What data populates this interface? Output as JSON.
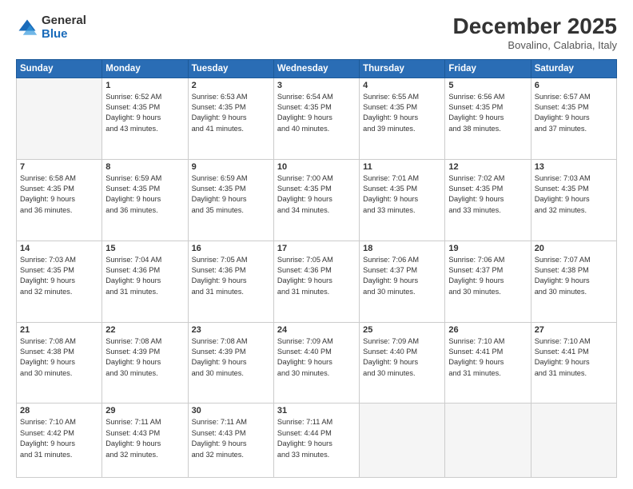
{
  "logo": {
    "general": "General",
    "blue": "Blue"
  },
  "header": {
    "month": "December 2025",
    "location": "Bovalino, Calabria, Italy"
  },
  "weekdays": [
    "Sunday",
    "Monday",
    "Tuesday",
    "Wednesday",
    "Thursday",
    "Friday",
    "Saturday"
  ],
  "weeks": [
    [
      {
        "day": "",
        "lines": []
      },
      {
        "day": "1",
        "lines": [
          "Sunrise: 6:52 AM",
          "Sunset: 4:35 PM",
          "Daylight: 9 hours",
          "and 43 minutes."
        ]
      },
      {
        "day": "2",
        "lines": [
          "Sunrise: 6:53 AM",
          "Sunset: 4:35 PM",
          "Daylight: 9 hours",
          "and 41 minutes."
        ]
      },
      {
        "day": "3",
        "lines": [
          "Sunrise: 6:54 AM",
          "Sunset: 4:35 PM",
          "Daylight: 9 hours",
          "and 40 minutes."
        ]
      },
      {
        "day": "4",
        "lines": [
          "Sunrise: 6:55 AM",
          "Sunset: 4:35 PM",
          "Daylight: 9 hours",
          "and 39 minutes."
        ]
      },
      {
        "day": "5",
        "lines": [
          "Sunrise: 6:56 AM",
          "Sunset: 4:35 PM",
          "Daylight: 9 hours",
          "and 38 minutes."
        ]
      },
      {
        "day": "6",
        "lines": [
          "Sunrise: 6:57 AM",
          "Sunset: 4:35 PM",
          "Daylight: 9 hours",
          "and 37 minutes."
        ]
      }
    ],
    [
      {
        "day": "7",
        "lines": [
          "Sunrise: 6:58 AM",
          "Sunset: 4:35 PM",
          "Daylight: 9 hours",
          "and 36 minutes."
        ]
      },
      {
        "day": "8",
        "lines": [
          "Sunrise: 6:59 AM",
          "Sunset: 4:35 PM",
          "Daylight: 9 hours",
          "and 36 minutes."
        ]
      },
      {
        "day": "9",
        "lines": [
          "Sunrise: 6:59 AM",
          "Sunset: 4:35 PM",
          "Daylight: 9 hours",
          "and 35 minutes."
        ]
      },
      {
        "day": "10",
        "lines": [
          "Sunrise: 7:00 AM",
          "Sunset: 4:35 PM",
          "Daylight: 9 hours",
          "and 34 minutes."
        ]
      },
      {
        "day": "11",
        "lines": [
          "Sunrise: 7:01 AM",
          "Sunset: 4:35 PM",
          "Daylight: 9 hours",
          "and 33 minutes."
        ]
      },
      {
        "day": "12",
        "lines": [
          "Sunrise: 7:02 AM",
          "Sunset: 4:35 PM",
          "Daylight: 9 hours",
          "and 33 minutes."
        ]
      },
      {
        "day": "13",
        "lines": [
          "Sunrise: 7:03 AM",
          "Sunset: 4:35 PM",
          "Daylight: 9 hours",
          "and 32 minutes."
        ]
      }
    ],
    [
      {
        "day": "14",
        "lines": [
          "Sunrise: 7:03 AM",
          "Sunset: 4:35 PM",
          "Daylight: 9 hours",
          "and 32 minutes."
        ]
      },
      {
        "day": "15",
        "lines": [
          "Sunrise: 7:04 AM",
          "Sunset: 4:36 PM",
          "Daylight: 9 hours",
          "and 31 minutes."
        ]
      },
      {
        "day": "16",
        "lines": [
          "Sunrise: 7:05 AM",
          "Sunset: 4:36 PM",
          "Daylight: 9 hours",
          "and 31 minutes."
        ]
      },
      {
        "day": "17",
        "lines": [
          "Sunrise: 7:05 AM",
          "Sunset: 4:36 PM",
          "Daylight: 9 hours",
          "and 31 minutes."
        ]
      },
      {
        "day": "18",
        "lines": [
          "Sunrise: 7:06 AM",
          "Sunset: 4:37 PM",
          "Daylight: 9 hours",
          "and 30 minutes."
        ]
      },
      {
        "day": "19",
        "lines": [
          "Sunrise: 7:06 AM",
          "Sunset: 4:37 PM",
          "Daylight: 9 hours",
          "and 30 minutes."
        ]
      },
      {
        "day": "20",
        "lines": [
          "Sunrise: 7:07 AM",
          "Sunset: 4:38 PM",
          "Daylight: 9 hours",
          "and 30 minutes."
        ]
      }
    ],
    [
      {
        "day": "21",
        "lines": [
          "Sunrise: 7:08 AM",
          "Sunset: 4:38 PM",
          "Daylight: 9 hours",
          "and 30 minutes."
        ]
      },
      {
        "day": "22",
        "lines": [
          "Sunrise: 7:08 AM",
          "Sunset: 4:39 PM",
          "Daylight: 9 hours",
          "and 30 minutes."
        ]
      },
      {
        "day": "23",
        "lines": [
          "Sunrise: 7:08 AM",
          "Sunset: 4:39 PM",
          "Daylight: 9 hours",
          "and 30 minutes."
        ]
      },
      {
        "day": "24",
        "lines": [
          "Sunrise: 7:09 AM",
          "Sunset: 4:40 PM",
          "Daylight: 9 hours",
          "and 30 minutes."
        ]
      },
      {
        "day": "25",
        "lines": [
          "Sunrise: 7:09 AM",
          "Sunset: 4:40 PM",
          "Daylight: 9 hours",
          "and 30 minutes."
        ]
      },
      {
        "day": "26",
        "lines": [
          "Sunrise: 7:10 AM",
          "Sunset: 4:41 PM",
          "Daylight: 9 hours",
          "and 31 minutes."
        ]
      },
      {
        "day": "27",
        "lines": [
          "Sunrise: 7:10 AM",
          "Sunset: 4:41 PM",
          "Daylight: 9 hours",
          "and 31 minutes."
        ]
      }
    ],
    [
      {
        "day": "28",
        "lines": [
          "Sunrise: 7:10 AM",
          "Sunset: 4:42 PM",
          "Daylight: 9 hours",
          "and 31 minutes."
        ]
      },
      {
        "day": "29",
        "lines": [
          "Sunrise: 7:11 AM",
          "Sunset: 4:43 PM",
          "Daylight: 9 hours",
          "and 32 minutes."
        ]
      },
      {
        "day": "30",
        "lines": [
          "Sunrise: 7:11 AM",
          "Sunset: 4:43 PM",
          "Daylight: 9 hours",
          "and 32 minutes."
        ]
      },
      {
        "day": "31",
        "lines": [
          "Sunrise: 7:11 AM",
          "Sunset: 4:44 PM",
          "Daylight: 9 hours",
          "and 33 minutes."
        ]
      },
      {
        "day": "",
        "lines": []
      },
      {
        "day": "",
        "lines": []
      },
      {
        "day": "",
        "lines": []
      }
    ]
  ]
}
